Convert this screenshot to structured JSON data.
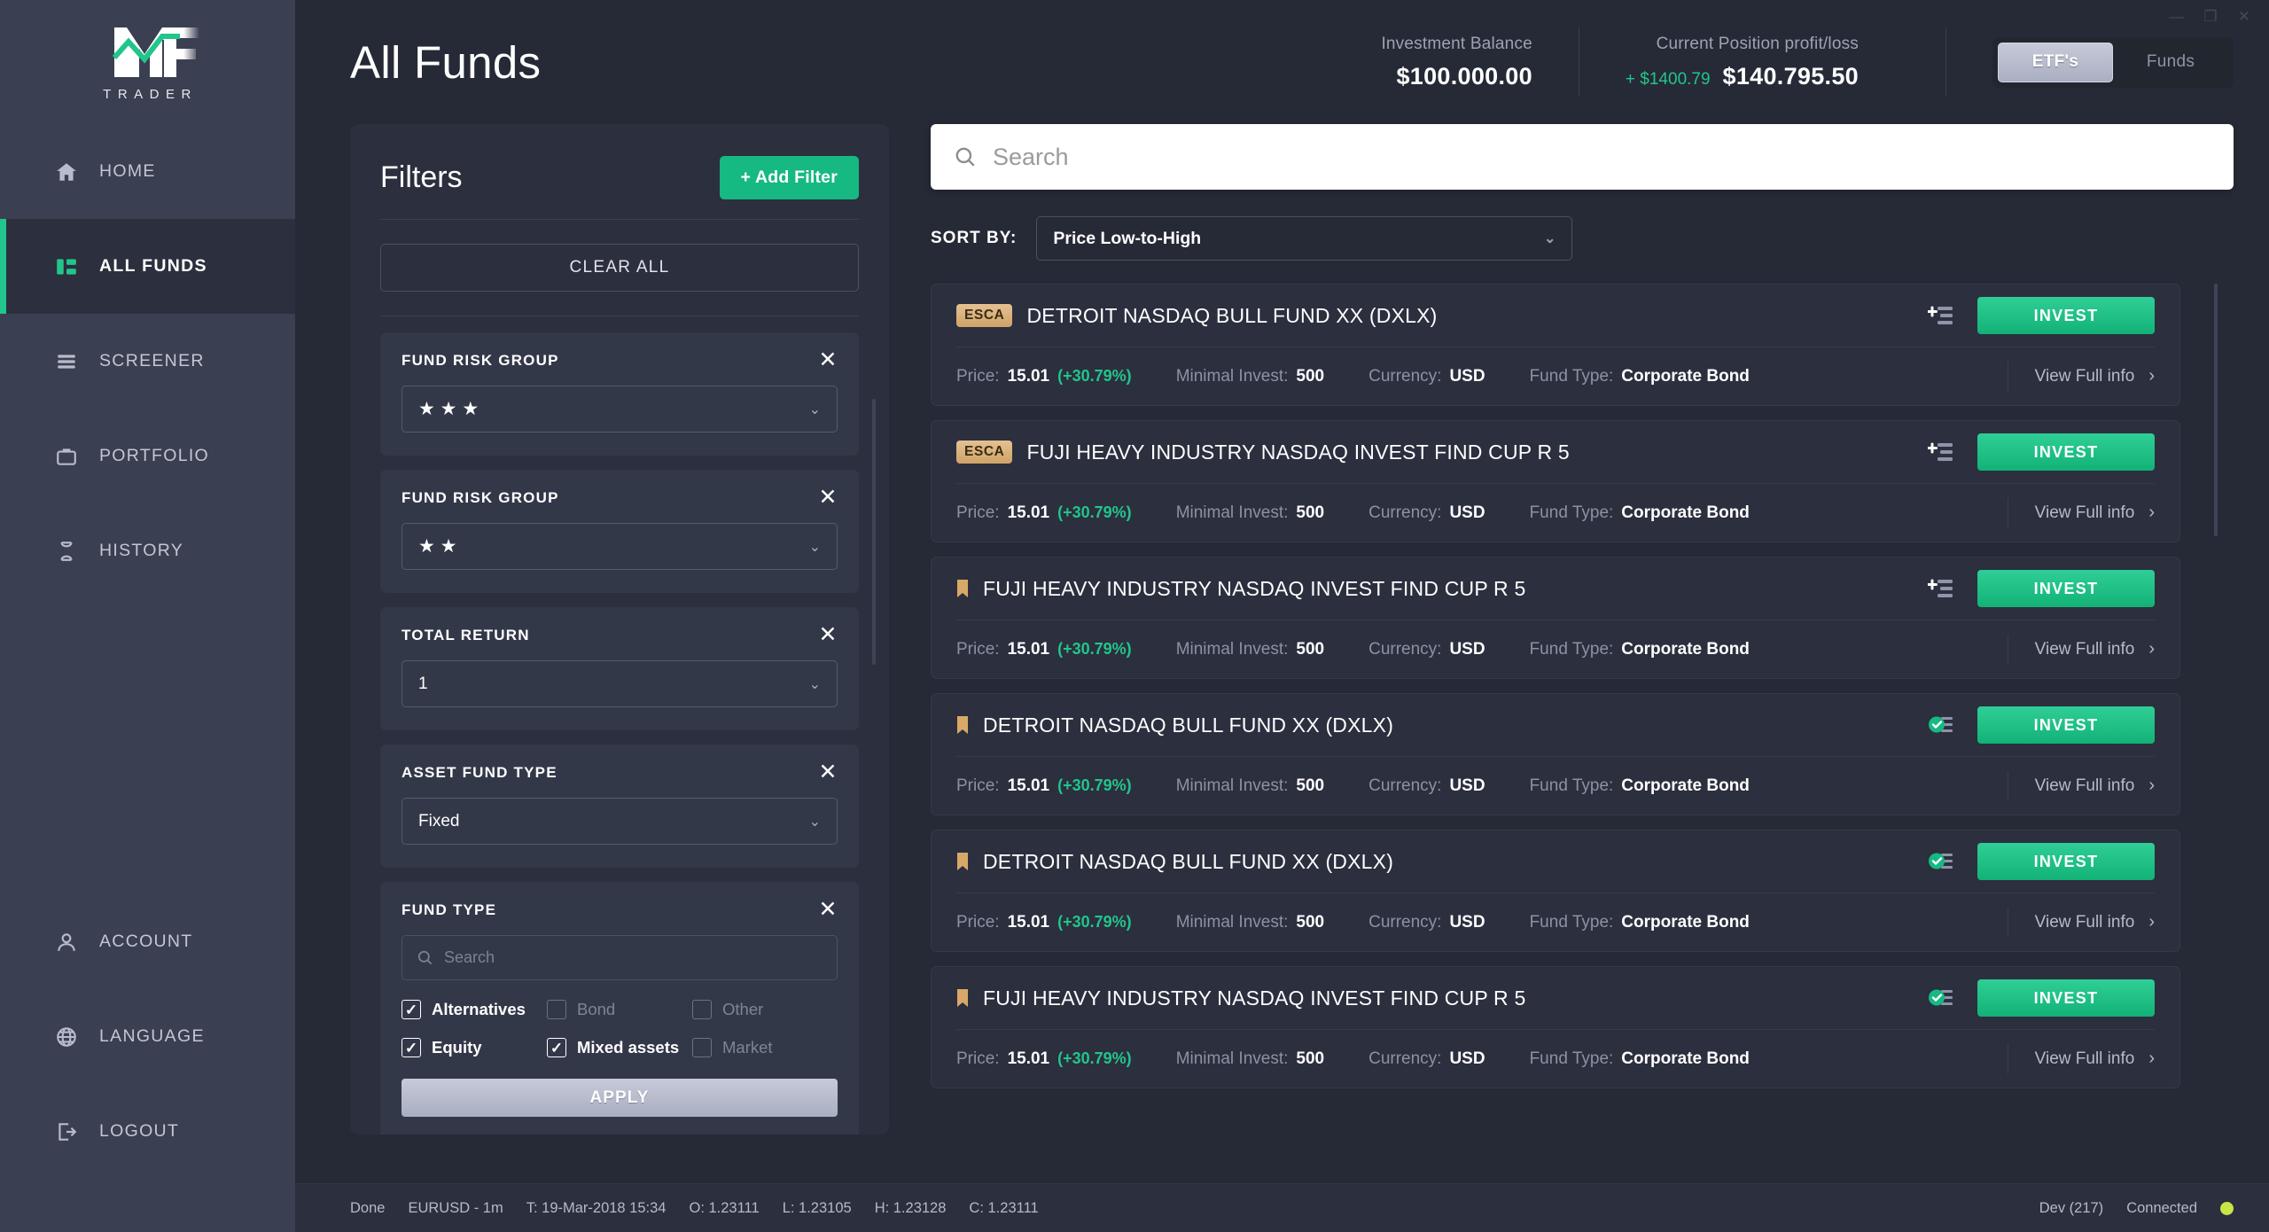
{
  "window": {
    "minimize": "—",
    "maximize": "❐",
    "close": "✕"
  },
  "brand": {
    "word": "TRADER"
  },
  "sidebar": {
    "items": [
      {
        "label": "HOME",
        "icon": "home-icon",
        "active": false
      },
      {
        "label": "ALL FUNDS",
        "icon": "grid-icon",
        "active": true
      },
      {
        "label": "SCREENER",
        "icon": "list-icon",
        "active": false
      },
      {
        "label": "PORTFOLIO",
        "icon": "briefcase-icon",
        "active": false
      },
      {
        "label": "HISTORY",
        "icon": "hourglass-icon",
        "active": false
      }
    ],
    "bottom_items": [
      {
        "label": "ACCOUNT",
        "icon": "user-icon"
      },
      {
        "label": "LANGUAGE",
        "icon": "globe-icon"
      },
      {
        "label": "LOGOUT",
        "icon": "logout-icon"
      }
    ]
  },
  "header": {
    "title": "All Funds",
    "investment_balance_label": "Investment Balance",
    "investment_balance_value": "$100.000.00",
    "profit_loss_label": "Current Position profit/loss",
    "profit_loss_delta": "+ $1400.79",
    "profit_loss_value": "$140.795.50",
    "segments": [
      {
        "label": "ETF's",
        "active": true
      },
      {
        "label": "Funds",
        "active": false
      }
    ]
  },
  "filters": {
    "title": "Filters",
    "add_filter_label": "+ Add Filter",
    "clear_all_label": "CLEAR ALL",
    "cards": [
      {
        "label": "FUND RISK GROUP",
        "type": "stars",
        "value": "★ ★ ★",
        "stars": 3,
        "close": "✕"
      },
      {
        "label": "FUND RISK GROUP",
        "type": "stars",
        "value": "★ ★",
        "stars": 2,
        "close": "✕"
      },
      {
        "label": "TOTAL RETURN",
        "type": "select",
        "value": "1",
        "close": "✕"
      },
      {
        "label": "ASSET FUND TYPE",
        "type": "select",
        "value": "Fixed",
        "close": "✕"
      }
    ],
    "fund_type": {
      "label": "FUND TYPE",
      "close": "✕",
      "search_placeholder": "Search",
      "search_value": "",
      "options": [
        {
          "label": "Alternatives",
          "checked": true
        },
        {
          "label": "Bond",
          "checked": false
        },
        {
          "label": "Other",
          "checked": false
        },
        {
          "label": "Equity",
          "checked": true
        },
        {
          "label": "Mixed assets",
          "checked": true
        },
        {
          "label": "Market",
          "checked": false
        }
      ],
      "apply_label": "APPLY"
    }
  },
  "search": {
    "placeholder": "Search",
    "value": "",
    "icon": "search-icon"
  },
  "sort": {
    "label": "SORT BY:",
    "value": "Price Low-to-High",
    "chevron": "⌄"
  },
  "funds": {
    "columns": {
      "price": "Price:",
      "minimal_invest": "Minimal Invest:",
      "currency": "Currency:",
      "fund_type": "Fund Type:",
      "view_full_info": "View Full info",
      "invest": "INVEST"
    },
    "rows": [
      {
        "badge": "ESCA",
        "badge_type": "esca",
        "name": "DETROIT NASDAQ BULL FUND XX (DXLX)",
        "price": "15.01",
        "change": "(+30.79%)",
        "minimal_invest": "500",
        "currency": "USD",
        "fund_type": "Corporate Bond",
        "action_icon": "add-to-list-icon",
        "invest_label": "INVEST",
        "view_label": "View Full info"
      },
      {
        "badge": "ESCA",
        "badge_type": "esca",
        "name": "FUJI HEAVY INDUSTRY NASDAQ INVEST FIND CUP R 5",
        "price": "15.01",
        "change": "(+30.79%)",
        "minimal_invest": "500",
        "currency": "USD",
        "fund_type": "Corporate Bond",
        "action_icon": "add-to-list-icon",
        "invest_label": "INVEST",
        "view_label": "View Full info"
      },
      {
        "badge": "",
        "badge_type": "bookmark",
        "name": "FUJI HEAVY INDUSTRY NASDAQ INVEST FIND CUP R 5",
        "price": "15.01",
        "change": "(+30.79%)",
        "minimal_invest": "500",
        "currency": "USD",
        "fund_type": "Corporate Bond",
        "action_icon": "add-to-list-icon",
        "invest_label": "INVEST",
        "view_label": "View Full info"
      },
      {
        "badge": "",
        "badge_type": "bookmark",
        "name": "DETROIT NASDAQ BULL FUND XX (DXLX)",
        "price": "15.01",
        "change": "(+30.79%)",
        "minimal_invest": "500",
        "currency": "USD",
        "fund_type": "Corporate Bond",
        "action_icon": "added-to-list-icon",
        "invest_label": "INVEST",
        "view_label": "View Full info"
      },
      {
        "badge": "",
        "badge_type": "bookmark",
        "name": "DETROIT NASDAQ BULL FUND XX (DXLX)",
        "price": "15.01",
        "change": "(+30.79%)",
        "minimal_invest": "500",
        "currency": "USD",
        "fund_type": "Corporate Bond",
        "action_icon": "added-to-list-icon",
        "invest_label": "INVEST",
        "view_label": "View Full info"
      },
      {
        "badge": "",
        "badge_type": "bookmark",
        "name": "FUJI HEAVY INDUSTRY NASDAQ INVEST FIND CUP R 5",
        "price": "15.01",
        "change": "(+30.79%)",
        "minimal_invest": "500",
        "currency": "USD",
        "fund_type": "Corporate Bond",
        "action_icon": "added-to-list-icon",
        "invest_label": "INVEST",
        "view_label": "View Full info"
      }
    ]
  },
  "statusbar": {
    "left": [
      "Done",
      "EURUSD - 1m",
      "T: 19-Mar-2018 15:34",
      "O: 1.23111",
      "L: 1.23105",
      "H: 1.23128",
      "C: 1.23111"
    ],
    "dev": "Dev (217)",
    "connection": "Connected",
    "dot_color": "#c8e645"
  },
  "colors": {
    "accent": "#22c58b",
    "sidebar": "#3a3f51",
    "panel": "#2b2f3e",
    "bg": "#262a36",
    "badge": "#cfa368"
  }
}
